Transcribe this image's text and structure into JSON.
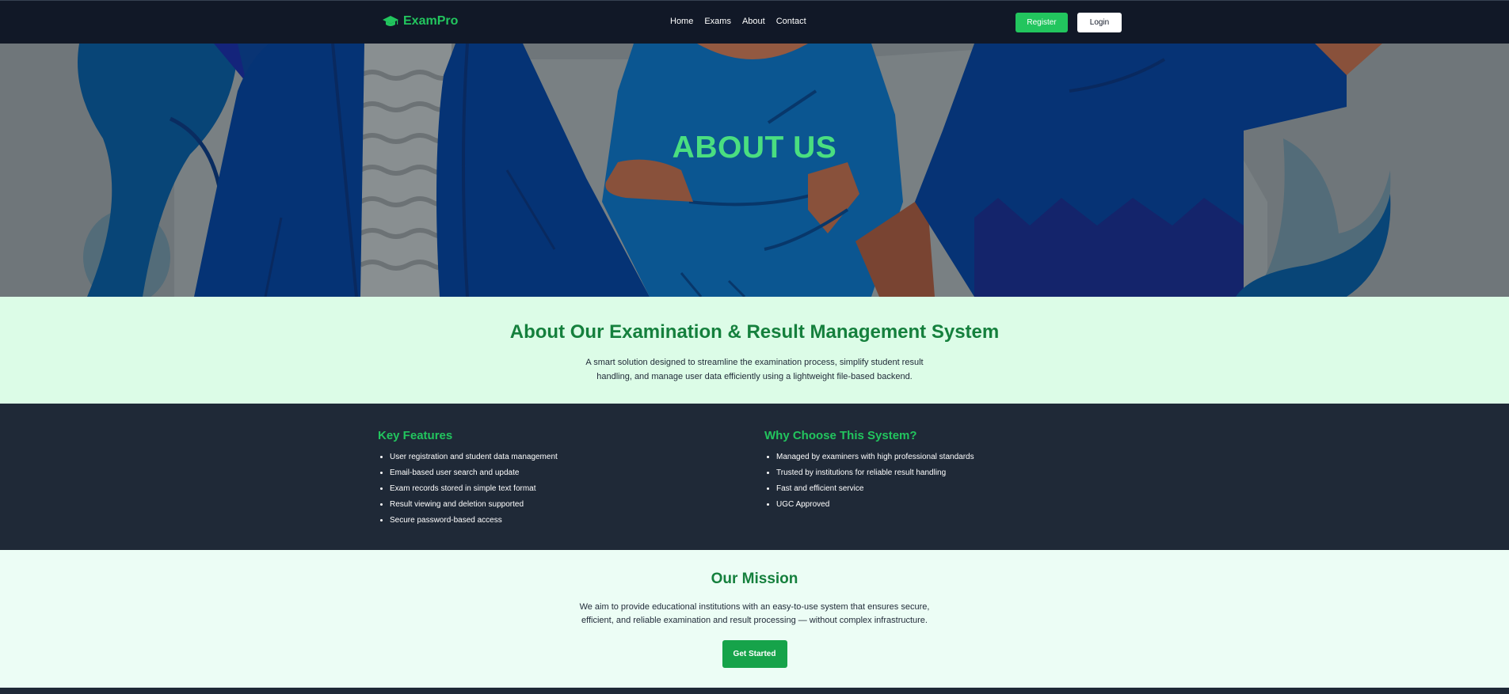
{
  "navbar": {
    "brand": "ExamPro",
    "brand_icon": "graduation-cap-icon",
    "links": [
      "Home",
      "Exams",
      "About",
      "Contact"
    ],
    "register_label": "Register",
    "login_label": "Login"
  },
  "hero": {
    "title": "ABOUT US"
  },
  "intro": {
    "heading": "About Our Examination & Result Management System",
    "text": "A smart solution designed to streamline the examination process, simplify student result handling, and manage user data efficiently using a lightweight file-based backend."
  },
  "features": {
    "key_heading": "Key Features",
    "key_items": [
      "User registration and student data management",
      "Email-based user search and update",
      "Exam records stored in simple text format",
      "Result viewing and deletion supported",
      "Secure password-based access"
    ],
    "why_heading": "Why Choose This System?",
    "why_items": [
      "Managed by examiners with high professional standards",
      "Trusted by institutions for reliable result handling",
      "Fast and efficient service",
      "UGC Approved"
    ]
  },
  "mission": {
    "heading": "Our Mission",
    "text": "We aim to provide educational institutions with an easy-to-use system that ensures secure, efficient, and reliable examination and result processing — without complex infrastructure.",
    "button_label": "Get Started"
  },
  "colors": {
    "accent": "#22c55e",
    "dark": "#111827",
    "panel": "#1f2937",
    "intro_bg": "#dcfce7",
    "mission_bg": "#ecfdf5"
  }
}
